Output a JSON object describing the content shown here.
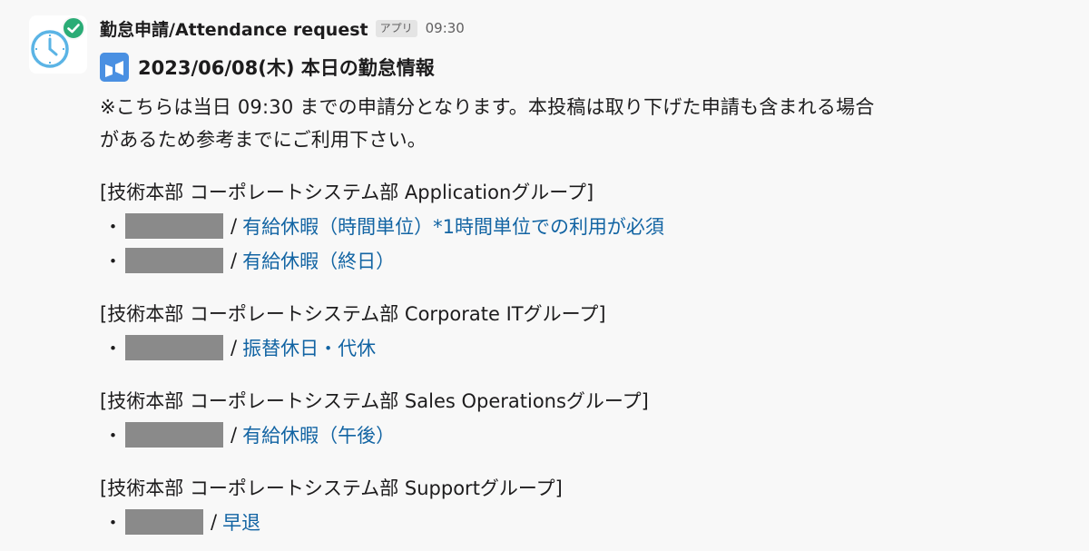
{
  "avatar": {
    "icon": "clock-icon",
    "badge": "check-circle-icon",
    "badge_color": "#2bac76"
  },
  "header": {
    "app_name": "勤怠申請/Attendance request",
    "app_tag": "アプリ",
    "time": "09:30"
  },
  "message": {
    "title_icon": "calendar-icon",
    "title": "2023/06/08(木) 本日の勤怠情報",
    "notice_line1": "※こちらは当日 09:30 までの申請分となります。本投稿は取り下げた申請も含まれる場合",
    "notice_line2": "があるため参考までにご利用下さい。",
    "groups": [
      {
        "title": "[技術本部 コーポレートシステム部 Applicationグループ]",
        "entries": [
          {
            "bullet": "・",
            "sep": "/",
            "type": "有給休暇（時間単位）*1時間単位での利用が必須"
          },
          {
            "bullet": "・",
            "sep": "/",
            "type": "有給休暇（終日）"
          }
        ]
      },
      {
        "title": "[技術本部 コーポレートシステム部 Corporate ITグループ]",
        "entries": [
          {
            "bullet": "・",
            "sep": "/",
            "type": "振替休日・代休"
          }
        ]
      },
      {
        "title": "[技術本部 コーポレートシステム部 Sales Operationsグループ]",
        "entries": [
          {
            "bullet": "・",
            "sep": "/",
            "type": "有給休暇（午後）"
          }
        ]
      },
      {
        "title": "[技術本部 コーポレートシステム部 Supportグループ]",
        "entries": [
          {
            "bullet": "・",
            "sep": "/",
            "type": "早退"
          }
        ]
      }
    ]
  },
  "colors": {
    "link": "#1264a3",
    "redaction": "#8a8a8a",
    "title_icon": "#4a90e2",
    "clock": "#5bb4e5"
  }
}
